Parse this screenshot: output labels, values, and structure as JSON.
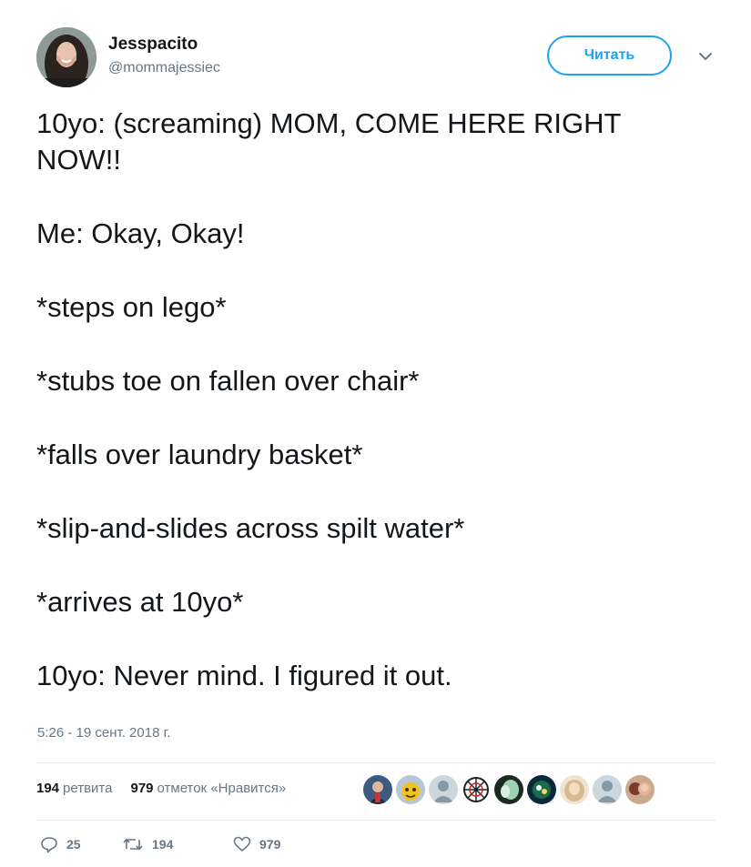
{
  "user": {
    "display_name": "Jesspacito",
    "handle": "@mommajessiec",
    "avatar_icon": "profile-photo"
  },
  "follow_button": {
    "label": "Читать"
  },
  "menu": {
    "icon": "chevron-down-icon"
  },
  "tweet": {
    "paragraphs": [
      "10yo: (screaming) MOM, COME HERE RIGHT NOW!!",
      "Me: Okay, Okay!",
      "*steps on lego*",
      "*stubs toe on fallen over chair*",
      "*falls over laundry basket*",
      "*slip-and-slides across spilt water*",
      "*arrives at 10yo*",
      "10yo: Never mind. I figured it out."
    ],
    "timestamp": "5:26 - 19 сент. 2018 г."
  },
  "stats": {
    "retweets_count": "194",
    "retweets_label": "ретвита",
    "likes_count": "979",
    "likes_label": "отметок «Нравится»"
  },
  "likers": [
    {
      "icon": "user-avatar"
    },
    {
      "icon": "user-avatar"
    },
    {
      "icon": "default-avatar"
    },
    {
      "icon": "user-avatar"
    },
    {
      "icon": "user-avatar"
    },
    {
      "icon": "user-avatar"
    },
    {
      "icon": "user-avatar"
    },
    {
      "icon": "default-avatar"
    },
    {
      "icon": "user-avatar"
    }
  ],
  "actions": {
    "reply_count": "25",
    "retweet_count": "194",
    "like_count": "979"
  },
  "colors": {
    "accent": "#1da1f2",
    "text": "#14171a",
    "muted": "#657786",
    "divider": "#e6ecf0"
  }
}
